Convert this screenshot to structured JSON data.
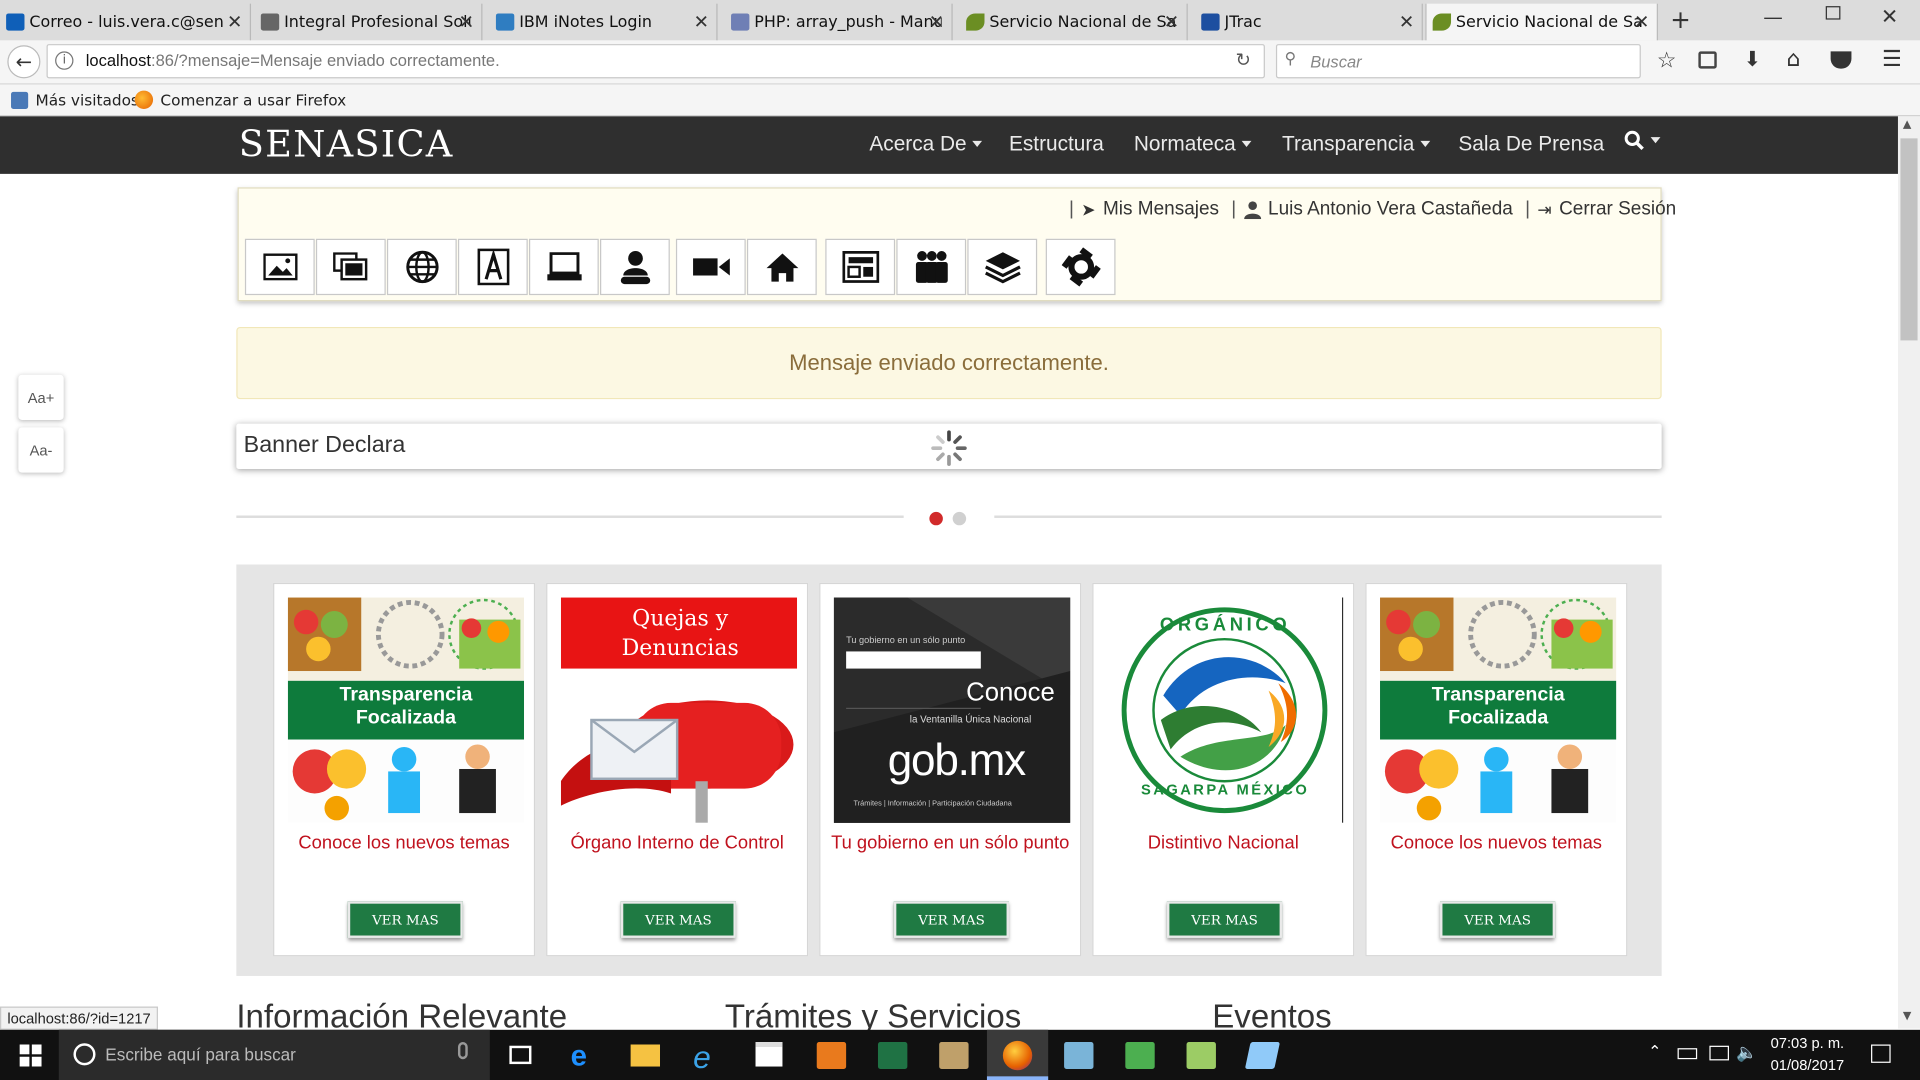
{
  "browser": {
    "tabs": [
      {
        "label": "Correo - luis.vera.c@sen",
        "icon": "outlook-icon",
        "color": "#0f5fb8"
      },
      {
        "label": "Integral Profesional Solu",
        "icon": "building-icon",
        "color": "#555555"
      },
      {
        "label": "IBM iNotes Login",
        "icon": "inotes-icon",
        "color": "#2f7dc1"
      },
      {
        "label": "PHP: array_push - Manua",
        "icon": "php-icon",
        "color": "#6f7fb5"
      },
      {
        "label": "Servicio Nacional de Sa",
        "icon": "senasica-bird-icon",
        "color": "#6b8e23"
      },
      {
        "label": "JTrac",
        "icon": "jtrac-icon",
        "color": "#1d4fa0"
      },
      {
        "label": "Servicio Nacional de Sa",
        "icon": "senasica-bird-icon",
        "color": "#6b8e23"
      }
    ],
    "url_host": "localhost",
    "url_rest": ":86/?mensaje=Mensaje enviado correctamente.",
    "search_placeholder": "Buscar",
    "bookmarks": [
      "Más visitados",
      "Comenzar a usar Firefox"
    ],
    "status_url": "localhost:86/?id=1217"
  },
  "site": {
    "logo": "SENASICA",
    "menu": [
      "Acerca De",
      "Estructura",
      "Normateca",
      "Transparencia",
      "Sala De Prensa"
    ],
    "user_links": {
      "messages": "Mis Mensajes",
      "user_name": "Luis Antonio Vera Castañeda",
      "logout": "Cerrar Sesión"
    },
    "toolbar_icons": [
      "image-icon",
      "gallery-icon",
      "globe-icon",
      "text-box-icon",
      "laptop-icon",
      "person-icon",
      "video-camera-icon",
      "home-icon",
      "layout-icon",
      "group-icon",
      "layers-icon",
      "aperture-icon"
    ],
    "font_increase": "Aa+",
    "font_decrease": "Aa-",
    "alert": "Mensaje enviado correctamente.",
    "banner_title": "Banner Declara",
    "cards": [
      {
        "title": "Conoce los nuevos temas",
        "image_text": "Transparencia Focalizada",
        "button": "VER MAS"
      },
      {
        "title": "Órgano Interno de Control",
        "image_text": "Quejas y Denuncias",
        "button": "VER MAS"
      },
      {
        "title": "Tu gobierno en un sólo punto",
        "image_text_1": "Conoce",
        "image_text_2": "la Ventanilla Única Nacional",
        "image_text_3": "gob.mx",
        "image_text_4": "Tu gobierno en un sólo punto",
        "image_text_5": "Trámites | Información | Participación Ciudadana",
        "button": "VER MAS"
      },
      {
        "title": "Distintivo Nacional",
        "image_text_1": "ORGÁNICO",
        "image_text_2": "SAGARPA MÉXICO",
        "button": "VER MAS"
      },
      {
        "title": "Conoce los nuevos temas",
        "image_text": "Transparencia Focalizada",
        "button": "VER MAS"
      }
    ],
    "sections": [
      "Información Relevante",
      "Trámites y Servicios",
      "Eventos"
    ]
  },
  "taskbar": {
    "search_placeholder": "Escribe aquí para buscar",
    "time": "07:03 p. m.",
    "date": "01/08/2017",
    "apps": [
      "task-view-icon",
      "edge-icon",
      "file-explorer-icon",
      "internet-explorer-icon",
      "store-icon",
      "outlook-icon",
      "excel-icon",
      "tools-icon",
      "firefox-icon",
      "app-icon",
      "media-icon",
      "notepad-icon",
      "app2-icon"
    ]
  },
  "colors": {
    "header_bg": "#2f2f2f",
    "alert_bg": "#fcf8e3",
    "alert_text": "#8a6d3b",
    "card_title": "#c0121e",
    "button_green": "#1f7a43"
  }
}
